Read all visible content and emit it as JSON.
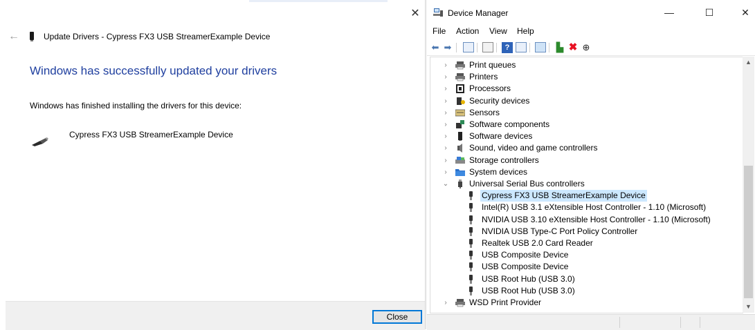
{
  "wizard": {
    "close_glyph": "✕",
    "back_glyph": "←",
    "title": "Update Drivers - Cypress FX3 USB StreamerExample Device",
    "heading": "Windows has successfully updated your drivers",
    "description": "Windows has finished installing the drivers for this device:",
    "device_name": "Cypress FX3 USB StreamerExample Device",
    "close_button": "Close"
  },
  "device_manager": {
    "title": "Device Manager",
    "window_buttons": {
      "minimize": "—",
      "maximize": "☐",
      "close": "✕"
    },
    "menu": [
      "File",
      "Action",
      "View",
      "Help"
    ],
    "toolbar_icons": [
      "back-arrow-icon",
      "forward-arrow-icon",
      "properties-icon",
      "show-hidden-icon",
      "help-icon",
      "console-tree-icon",
      "monitor-icon",
      "update-driver-icon",
      "uninstall-icon",
      "download-icon"
    ],
    "tree": {
      "categories_before": [
        {
          "label": "Print queues",
          "icon": "printer-icon"
        },
        {
          "label": "Printers",
          "icon": "printer-icon"
        },
        {
          "label": "Processors",
          "icon": "processor-icon"
        },
        {
          "label": "Security devices",
          "icon": "security-device-icon"
        },
        {
          "label": "Sensors",
          "icon": "sensor-icon"
        },
        {
          "label": "Software components",
          "icon": "puzzle-icon"
        },
        {
          "label": "Software devices",
          "icon": "software-device-icon"
        },
        {
          "label": "Sound, video and game controllers",
          "icon": "speaker-icon"
        },
        {
          "label": "Storage controllers",
          "icon": "storage-icon"
        },
        {
          "label": "System devices",
          "icon": "folder-icon"
        }
      ],
      "expanded_category": {
        "label": "Universal Serial Bus controllers",
        "icon": "usb-icon"
      },
      "usb_children": [
        {
          "label": "Cypress FX3 USB StreamerExample Device",
          "selected": true
        },
        {
          "label": "Intel(R) USB 3.1 eXtensible Host Controller - 1.10 (Microsoft)",
          "selected": false
        },
        {
          "label": "NVIDIA USB 3.10 eXtensible Host Controller - 1.10 (Microsoft)",
          "selected": false
        },
        {
          "label": "NVIDIA USB Type-C Port Policy Controller",
          "selected": false
        },
        {
          "label": "Realtek USB 2.0 Card Reader",
          "selected": false
        },
        {
          "label": "USB Composite Device",
          "selected": false
        },
        {
          "label": "USB Composite Device",
          "selected": false
        },
        {
          "label": "USB Root Hub (USB 3.0)",
          "selected": false
        },
        {
          "label": "USB Root Hub (USB 3.0)",
          "selected": false
        }
      ],
      "categories_after": [
        {
          "label": "WSD Print Provider",
          "icon": "printer-icon"
        }
      ]
    },
    "colors": {
      "selection": "#cce8ff",
      "heading_blue": "#1f3f9f",
      "uninstall_red": "#e81123"
    }
  }
}
